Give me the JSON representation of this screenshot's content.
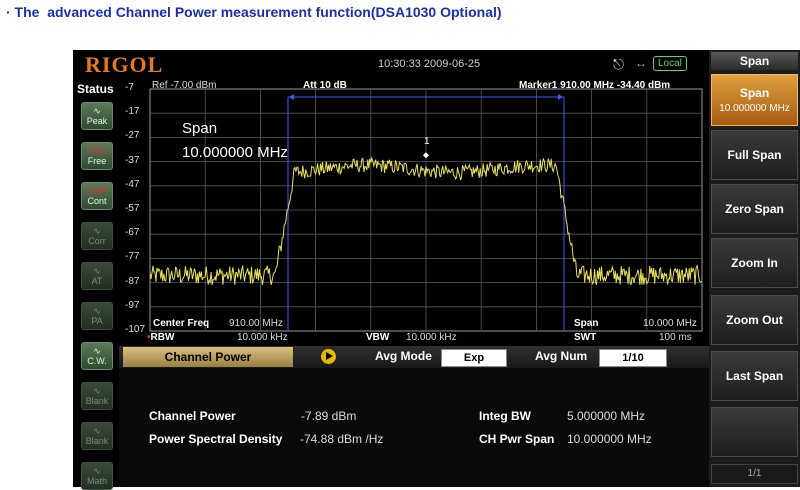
{
  "caption": "· The  advanced Channel Power measurement function(DSA1030 Optional)",
  "header": {
    "logo": "RIGOL",
    "datetime": "10:30:33 2009-06-25",
    "local_label": "Local"
  },
  "status": {
    "title": "Status",
    "buttons": [
      {
        "top": "",
        "bottom": "Peak",
        "icon": "peak-icon",
        "dim": false
      },
      {
        "top": "TRIG",
        "bottom": "Free",
        "icon": "trig-icon",
        "dim": false
      },
      {
        "top": "SWP",
        "bottom": "Cont",
        "icon": "sweep-icon",
        "dim": false
      },
      {
        "top": "",
        "bottom": "Corr",
        "icon": "corr-icon",
        "dim": true
      },
      {
        "top": "",
        "bottom": "AT",
        "icon": "atten-icon",
        "dim": true
      },
      {
        "top": "",
        "bottom": "PA",
        "icon": "preamp-icon",
        "dim": true
      },
      {
        "top": "",
        "bottom": "C.W.",
        "icon": "cw-icon",
        "dim": false
      },
      {
        "top": "",
        "bottom": "Blank",
        "icon": "blank-icon",
        "dim": true
      },
      {
        "top": "",
        "bottom": "Blank",
        "icon": "blank-icon",
        "dim": true
      },
      {
        "top": "",
        "bottom": "Math",
        "icon": "math-icon",
        "dim": true
      }
    ]
  },
  "graph": {
    "ref": "Ref -7.00 dBm",
    "att": "Att   10 dB",
    "marker": "Marker1   910.00 MHz  -34.40 dBm",
    "marker_num": "1",
    "y_ticks": [
      "-7",
      "-17",
      "-27",
      "-37",
      "-47",
      "-57",
      "-67",
      "-77",
      "-87",
      "-97",
      "-107"
    ],
    "span_label": "Span",
    "span_value": "10.000000 MHz",
    "center_freq_label": "Center Freq",
    "center_freq_value": "910.00 MHz",
    "rbw_label": "RBW",
    "rbw_value": "10.000 kHz",
    "vbw_label": "VBW",
    "vbw_value": "10.000 kHz",
    "span_bottom_label": "Span",
    "span_bottom_value": "10.000 MHz",
    "swt_label": "SWT",
    "swt_value": "100 ms"
  },
  "panel": {
    "title": "Channel Power",
    "avg_mode_label": "Avg Mode",
    "avg_mode_value": "Exp",
    "avg_num_label": "Avg Num",
    "avg_num_value": "1/10",
    "channel_power_label": "Channel Power",
    "channel_power_value": "-7.89 dBm",
    "psd_label": "Power Spectral Density",
    "psd_value": "-74.88 dBm /Hz",
    "integ_bw_label": "Integ BW",
    "integ_bw_value": "5.000000 MHz",
    "ch_pwr_span_label": "CH Pwr Span",
    "ch_pwr_span_value": "10.000000 MHz"
  },
  "menu": {
    "title": "Span",
    "span_label": "Span",
    "span_value": "10.000000 MHz",
    "full_span": "Full Span",
    "zero_span": "Zero Span",
    "zoom_in": "Zoom In",
    "zoom_out": "Zoom Out",
    "last_span": "Last Span",
    "page": "1/1"
  },
  "colors": {
    "trace": "#e6e05a",
    "channel_lines": "#3a5cff",
    "active_softkey": "#d4892a",
    "caption": "#1a2fb0"
  }
}
